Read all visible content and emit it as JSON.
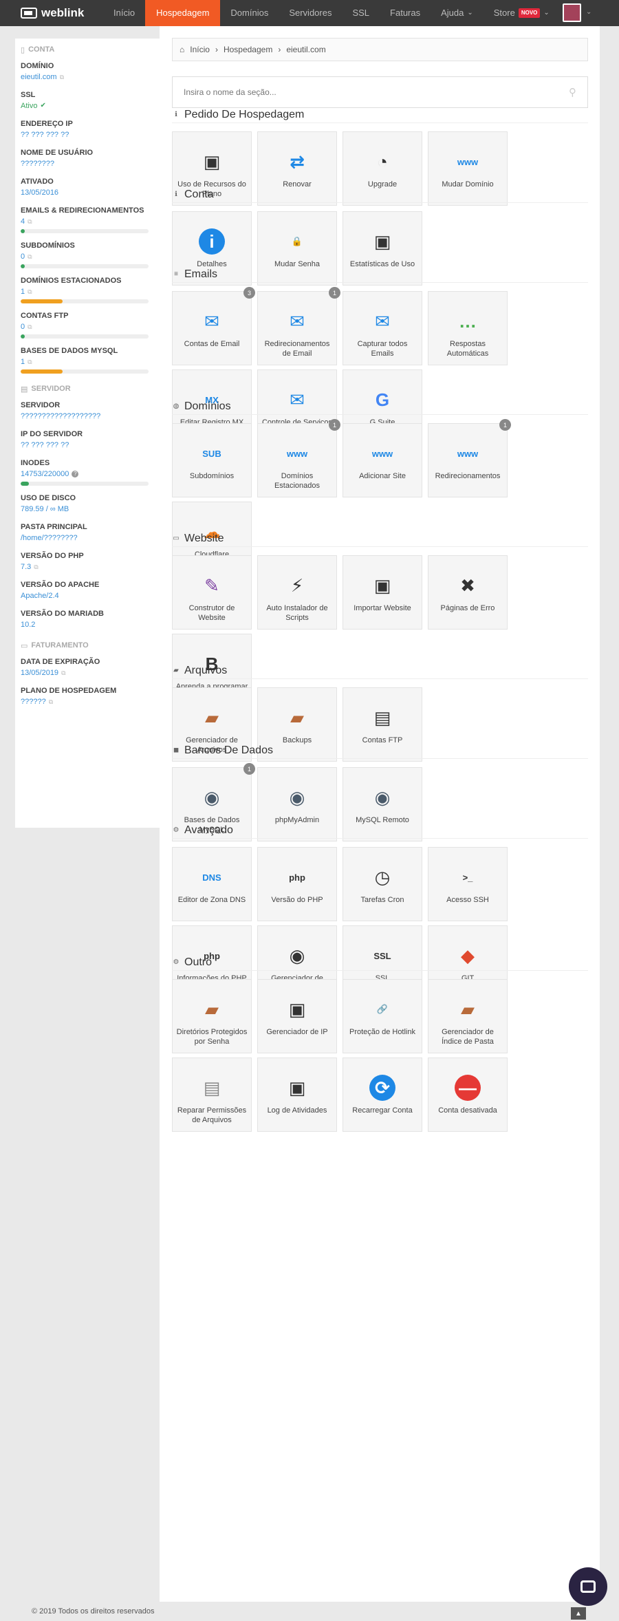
{
  "brand": {
    "name": "weblink"
  },
  "nav": [
    {
      "label": "Início"
    },
    {
      "label": "Hospedagem",
      "active": true
    },
    {
      "label": "Domínios"
    },
    {
      "label": "Servidores"
    },
    {
      "label": "SSL"
    },
    {
      "label": "Faturas"
    },
    {
      "label": "Ajuda",
      "chevron": true
    },
    {
      "label": "Store",
      "badge": "NOVO",
      "chevron": true
    }
  ],
  "sidebar": {
    "conta_head": "CONTA",
    "conta": [
      {
        "label": "DOMÍNIO",
        "value": "eieutil.com",
        "ext": true
      },
      {
        "label": "SSL",
        "value": "Ativo",
        "green": true
      },
      {
        "label": "ENDEREÇO IP",
        "value": "?? ??? ??? ??"
      },
      {
        "label": "NOME DE USUÁRIO",
        "value": "????????"
      },
      {
        "label": "ATIVADO",
        "value": "13/05/2016"
      },
      {
        "label": "EMAILS & REDIRECIONAMENTOS",
        "value": "4",
        "ext": true,
        "progress": 0.03,
        "pcolor": "#3aa45e"
      },
      {
        "label": "SUBDOMÍNIOS",
        "value": "0",
        "ext": true,
        "progress": 0,
        "pcolor": "#3aa45e"
      },
      {
        "label": "DOMÍNIOS ESTACIONADOS",
        "value": "1",
        "ext": true,
        "progress": 0.33,
        "pcolor": "#f0a020"
      },
      {
        "label": "CONTAS FTP",
        "value": "0",
        "ext": true,
        "progress": 0,
        "pcolor": "#3aa45e"
      },
      {
        "label": "BASES DE DADOS MYSQL",
        "value": "1",
        "ext": true,
        "progress": 0.33,
        "pcolor": "#f0a020"
      }
    ],
    "servidor_head": "SERVIDOR",
    "servidor": [
      {
        "label": "SERVIDOR",
        "value": "???????????????????"
      },
      {
        "label": "IP DO SERVIDOR",
        "value": "?? ??? ??? ??"
      },
      {
        "label": "INODES",
        "value": "14753/220000",
        "help": true,
        "progress": 0.067,
        "pcolor": "#3aa45e"
      },
      {
        "label": "USO DE DISCO",
        "value": "789.59 / ∞ MB"
      },
      {
        "label": "PASTA PRINCIPAL",
        "value": "/home/????????"
      },
      {
        "label": "VERSÃO DO PHP",
        "value": "7.3",
        "ext": true
      },
      {
        "label": "VERSÃO DO APACHE",
        "value": "Apache/2.4"
      },
      {
        "label": "VERSÃO DO MARIADB",
        "value": "10.2"
      }
    ],
    "fat_head": "FATURAMENTO",
    "faturamento": [
      {
        "label": "DATA DE EXPIRAÇÃO",
        "value": "13/05/2019",
        "ext": true
      },
      {
        "label": "PLANO DE HOSPEDAGEM",
        "value": "??????",
        "ext": true
      }
    ]
  },
  "breadcrumb": [
    "Início",
    "Hospedagem",
    "eieutil.com"
  ],
  "search": {
    "placeholder": "Insira o nome da seção..."
  },
  "sections": [
    {
      "title": "Pedido De Hospedagem",
      "icon": "info-icon",
      "tiles": [
        {
          "label": "Uso de Recursos do Plano",
          "icon": "resource-usage-icon"
        },
        {
          "label": "Renovar",
          "icon": "renew-icon"
        },
        {
          "label": "Upgrade",
          "icon": "upgrade-icon"
        },
        {
          "label": "Mudar Domínio",
          "icon": "change-domain-icon"
        }
      ]
    },
    {
      "title": "Conta",
      "icon": "info-icon",
      "tiles": [
        {
          "label": "Detalhes",
          "icon": "details-icon"
        },
        {
          "label": "Mudar Senha",
          "icon": "change-password-icon"
        },
        {
          "label": "Estatísticas de Uso",
          "icon": "usage-stats-icon"
        }
      ]
    },
    {
      "title": "Emails",
      "icon": "list-icon",
      "tiles": [
        {
          "label": "Contas de Email",
          "icon": "email-accounts-icon",
          "count": "3"
        },
        {
          "label": "Redirecionamentos de Email",
          "icon": "email-forward-icon",
          "count": "1"
        },
        {
          "label": "Capturar todos Emails",
          "icon": "catch-all-icon"
        },
        {
          "label": "Respostas Automáticas",
          "icon": "autoresponder-icon"
        },
        {
          "label": "Editar Registro MX",
          "icon": "mx-record-icon"
        },
        {
          "label": "Controle de Serviços de Email",
          "icon": "email-services-icon"
        },
        {
          "label": "G Suite",
          "icon": "gsuite-icon"
        }
      ]
    },
    {
      "title": "Domínios",
      "icon": "globe-icon",
      "tiles": [
        {
          "label": "Subdomínios",
          "icon": "subdomains-icon"
        },
        {
          "label": "Domínios Estacionados",
          "icon": "parked-domains-icon",
          "count": "1"
        },
        {
          "label": "Adicionar Site",
          "icon": "add-site-icon"
        },
        {
          "label": "Redirecionamentos",
          "icon": "redirects-icon",
          "count": "1"
        },
        {
          "label": "Cloudflare",
          "icon": "cloudflare-icon"
        }
      ]
    },
    {
      "title": "Website",
      "icon": "monitor-icon",
      "tiles": [
        {
          "label": "Construtor de Website",
          "icon": "website-builder-icon"
        },
        {
          "label": "Auto Instalador de Scripts",
          "icon": "auto-installer-icon"
        },
        {
          "label": "Importar Website",
          "icon": "import-website-icon"
        },
        {
          "label": "Páginas de Erro",
          "icon": "error-pages-icon"
        },
        {
          "label": "Aprenda a programar",
          "icon": "learn-code-icon"
        }
      ]
    },
    {
      "title": "Arquivos",
      "icon": "folder-icon",
      "tiles": [
        {
          "label": "Gerenciador de Arquivos",
          "icon": "file-manager-icon"
        },
        {
          "label": "Backups",
          "icon": "backups-icon"
        },
        {
          "label": "Contas FTP",
          "icon": "ftp-accounts-icon"
        }
      ]
    },
    {
      "title": "Bancos De Dados",
      "icon": "database-icon",
      "tiles": [
        {
          "label": "Bases de Dados MySQL",
          "icon": "mysql-databases-icon",
          "count": "1"
        },
        {
          "label": "phpMyAdmin",
          "icon": "phpmyadmin-icon"
        },
        {
          "label": "MySQL Remoto",
          "icon": "remote-mysql-icon"
        }
      ]
    },
    {
      "title": "Avançado",
      "icon": "cogs-icon",
      "tiles": [
        {
          "label": "Editor de Zona DNS",
          "icon": "dns-editor-icon"
        },
        {
          "label": "Versão do PHP",
          "icon": "php-version-icon"
        },
        {
          "label": "Tarefas Cron",
          "icon": "cron-icon"
        },
        {
          "label": "Acesso SSH",
          "icon": "ssh-icon"
        },
        {
          "label": "Informações do PHP",
          "icon": "php-info-icon"
        },
        {
          "label": "Gerenciador de Cache",
          "icon": "cache-manager-icon"
        },
        {
          "label": "SSL",
          "icon": "ssl-icon"
        },
        {
          "label": "GIT",
          "icon": "git-icon"
        }
      ]
    },
    {
      "title": "Outro",
      "icon": "gear-icon",
      "tiles": [
        {
          "label": "Diretórios Protegidos por Senha",
          "icon": "protected-dirs-icon"
        },
        {
          "label": "Gerenciador de IP",
          "icon": "ip-manager-icon"
        },
        {
          "label": "Proteção de Hotlink",
          "icon": "hotlink-icon"
        },
        {
          "label": "Gerenciador de Índice de Pasta",
          "icon": "index-manager-icon"
        },
        {
          "label": "Reparar Permissões de Arquivos",
          "icon": "fix-permissions-icon"
        },
        {
          "label": "Log de Atividades",
          "icon": "activity-log-icon"
        },
        {
          "label": "Recarregar Conta",
          "icon": "reload-account-icon"
        },
        {
          "label": "Conta desativada",
          "icon": "disabled-account-icon"
        }
      ]
    }
  ],
  "footer": {
    "text": "© 2019 Todos os direitos reservados"
  }
}
